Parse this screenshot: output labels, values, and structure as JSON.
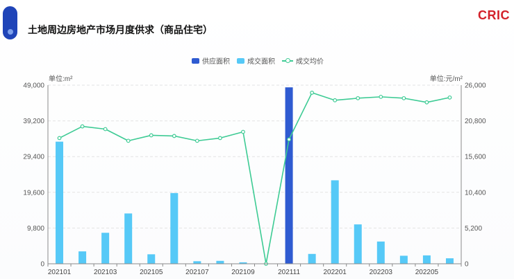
{
  "header": {
    "title": "土地周边房地产市场月度供求（商品住宅）",
    "brand": "CRIC"
  },
  "colors": {
    "supply": "#2f5bd1",
    "deal_area": "#56c9f7",
    "avg_price": "#3dcb94",
    "brand": "#d3212a"
  },
  "legend": {
    "supply": "供应面积",
    "deal_area": "成交面积",
    "avg_price": "成交均价"
  },
  "axes": {
    "left_unit": "单位:m²",
    "right_unit": "单位:元/m²"
  },
  "chart_data": {
    "type": "bar",
    "categories": [
      "202101",
      "202102",
      "202103",
      "202104",
      "202105",
      "202106",
      "202107",
      "202108",
      "202109",
      "202110",
      "202111",
      "202112",
      "202201",
      "202202",
      "202203",
      "202204",
      "202205",
      "202206"
    ],
    "x_tick_labels": [
      "202101",
      "",
      "202103",
      "",
      "202105",
      "",
      "202107",
      "",
      "202109",
      "",
      "202111",
      "",
      "202201",
      "",
      "202203",
      "",
      "202205",
      ""
    ],
    "series": [
      {
        "name": "供应面积",
        "type": "bar",
        "axis": "left",
        "values": [
          0,
          0,
          0,
          0,
          0,
          0,
          0,
          0,
          0,
          0,
          48400,
          0,
          0,
          0,
          0,
          0,
          0,
          0
        ]
      },
      {
        "name": "成交面积",
        "type": "bar",
        "axis": "left",
        "values": [
          33500,
          3400,
          8500,
          13800,
          2600,
          19400,
          700,
          800,
          400,
          0,
          0,
          2700,
          22900,
          10800,
          6100,
          2200,
          2300,
          1500
        ]
      },
      {
        "name": "成交均价",
        "type": "line",
        "axis": "right",
        "values": [
          18300,
          20000,
          19600,
          17900,
          18700,
          18600,
          17900,
          18300,
          19200,
          0,
          18100,
          24900,
          23800,
          24100,
          24300,
          24100,
          23500,
          24200
        ]
      }
    ],
    "y_left": {
      "min": 0,
      "max": 49000,
      "ticks": [
        0,
        9800,
        19600,
        29400,
        39200,
        49000
      ],
      "tick_labels": [
        "0",
        "9,800",
        "19,600",
        "29,400",
        "39,200",
        "49,000"
      ]
    },
    "y_right": {
      "min": 0,
      "max": 26000,
      "ticks": [
        0,
        5200,
        10400,
        15600,
        20800,
        26000
      ],
      "tick_labels": [
        "0",
        "5,200",
        "10,400",
        "15,600",
        "20,800",
        "26,000"
      ]
    },
    "grid": "horizontal dashed",
    "legend_position": "top-center"
  }
}
